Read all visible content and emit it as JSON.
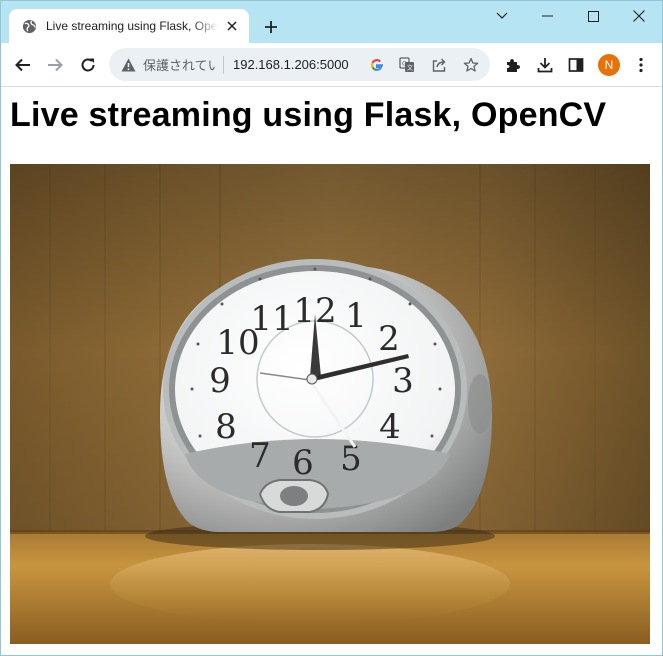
{
  "browser": {
    "tab": {
      "title": "Live streaming using Flask, OpenCV",
      "favicon": "globe-icon"
    },
    "new_tab_icon": "plus-icon",
    "window_controls": [
      "chevron-down-icon",
      "minimize-icon",
      "maximize-icon",
      "close-icon"
    ],
    "toolbar": {
      "back_icon": "arrow-left-icon",
      "forward_icon": "arrow-right-icon",
      "reload_icon": "reload-icon",
      "security_label": "保護されていない通信",
      "url": "192.168.1.206:5000",
      "omnibox_icons": [
        "google-icon",
        "translate-icon",
        "share-icon",
        "star-icon"
      ],
      "extension_icons": [
        "puzzle-icon",
        "download-icon",
        "side-panel-icon"
      ],
      "profile_initial": "N",
      "menu_icon": "kebab-menu-icon"
    },
    "colors": {
      "tabstrip": "#b6e4f2",
      "omnibox": "#eaf0f3",
      "avatar": "#e8710a"
    }
  },
  "page": {
    "heading": "Live streaming using Flask, OpenCV",
    "video_feed": {
      "subject": "analog alarm clock",
      "clock_numerals": [
        "12",
        "1",
        "2",
        "3",
        "4",
        "5",
        "6",
        "7",
        "8",
        "9",
        "10",
        "11"
      ]
    }
  }
}
